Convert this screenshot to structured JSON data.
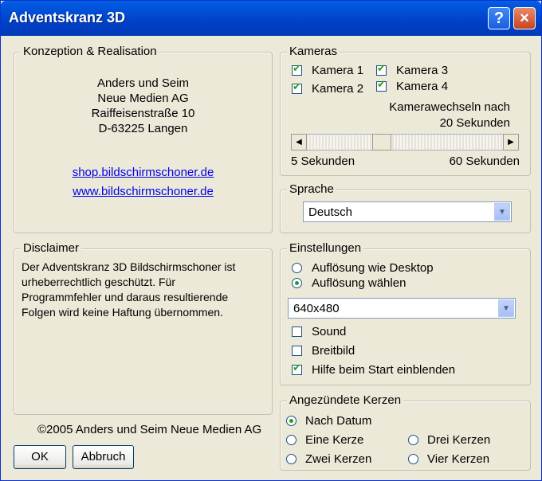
{
  "window": {
    "title": "Adventskranz 3D",
    "help_label": "?",
    "close_label": "×"
  },
  "konzeption": {
    "legend": "Konzeption & Realisation",
    "address": [
      "Anders und Seim",
      "Neue Medien AG",
      "Raiffeisenstraße 10",
      "D-63225 Langen"
    ],
    "links": [
      "shop.bildschirmschoner.de",
      "www.bildschirmschoner.de"
    ]
  },
  "disclaimer": {
    "legend": "Disclaimer",
    "lines": [
      "Der Adventskranz 3D Bildschirmschoner ist",
      "urheberrechtlich geschützt. Für",
      "Programmfehler und daraus resultierende",
      "Folgen wird keine Haftung übernommen."
    ]
  },
  "copyright": "©2005 Anders und Seim Neue Medien AG",
  "buttons": {
    "ok": "OK",
    "abbruch": "Abbruch"
  },
  "kameras": {
    "legend": "Kameras",
    "items": [
      {
        "label": "Kamera 1",
        "checked": true
      },
      {
        "label": "Kamera 3",
        "checked": true
      },
      {
        "label": "Kamera 2",
        "checked": true
      },
      {
        "label": "Kamera 4",
        "checked": true
      }
    ],
    "wechsel_line1": "Kamerawechseln nach",
    "wechsel_line2": "20 Sekunden",
    "slider_value_seconds": 20,
    "min_label": "5 Sekunden",
    "max_label": "60 Sekunden"
  },
  "sprache": {
    "legend": "Sprache",
    "selected": "Deutsch"
  },
  "einstellungen": {
    "legend": "Einstellungen",
    "radio_desktop": "Auflösung wie Desktop",
    "radio_waehlen": "Auflösung wählen",
    "resolution": "640x480",
    "sound": "Sound",
    "breitbild": "Breitbild",
    "hilfe": "Hilfe beim Start einblenden"
  },
  "kerzen": {
    "legend": "Angezündete Kerzen",
    "nach_datum": "Nach Datum",
    "eine": "Eine Kerze",
    "drei": "Drei Kerzen",
    "zwei": "Zwei Kerzen",
    "vier": "Vier Kerzen"
  }
}
